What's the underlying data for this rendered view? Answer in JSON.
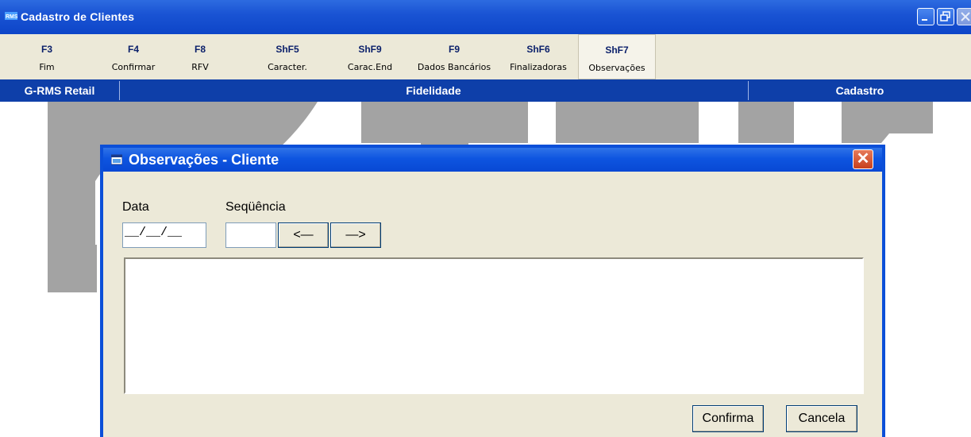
{
  "window": {
    "title": "Cadastro de Clientes",
    "app_icon": "rms-app-icon"
  },
  "toolbar": {
    "keys": [
      {
        "key": "F3",
        "label": "Fim"
      },
      {
        "key": "F4",
        "label": "Confirmar"
      },
      {
        "key": "F8",
        "label": "RFV"
      },
      {
        "key": "ShF5",
        "label": "Caracter."
      },
      {
        "key": "ShF9",
        "label": "Carac.End"
      },
      {
        "key": "F9",
        "label": "Dados Bancários"
      },
      {
        "key": "ShF6",
        "label": "Finalizadoras"
      },
      {
        "key": "ShF7",
        "label": "Observações"
      }
    ],
    "active_key": "ShF7"
  },
  "statusbar": {
    "left": "G-RMS Retail",
    "center": "Fidelidade",
    "right": "Cadastro"
  },
  "watermark": {
    "brand": "TOTVS",
    "color": "#9a9a9a"
  },
  "dialog": {
    "title": "Observações - Cliente",
    "data_label": "Data",
    "data_value": "__/__/__",
    "seq_label": "Seqüência",
    "seq_value": "",
    "prev_label": "<—",
    "next_label": "—>",
    "memo_value": "",
    "confirm_label": "Confirma",
    "cancel_label": "Cancela"
  },
  "colors": {
    "titlebar_blue": "#0d45c8",
    "statusbar_blue": "#0e3fa9",
    "dialog_border": "#0b4fd8",
    "face": "#ece9d8"
  }
}
